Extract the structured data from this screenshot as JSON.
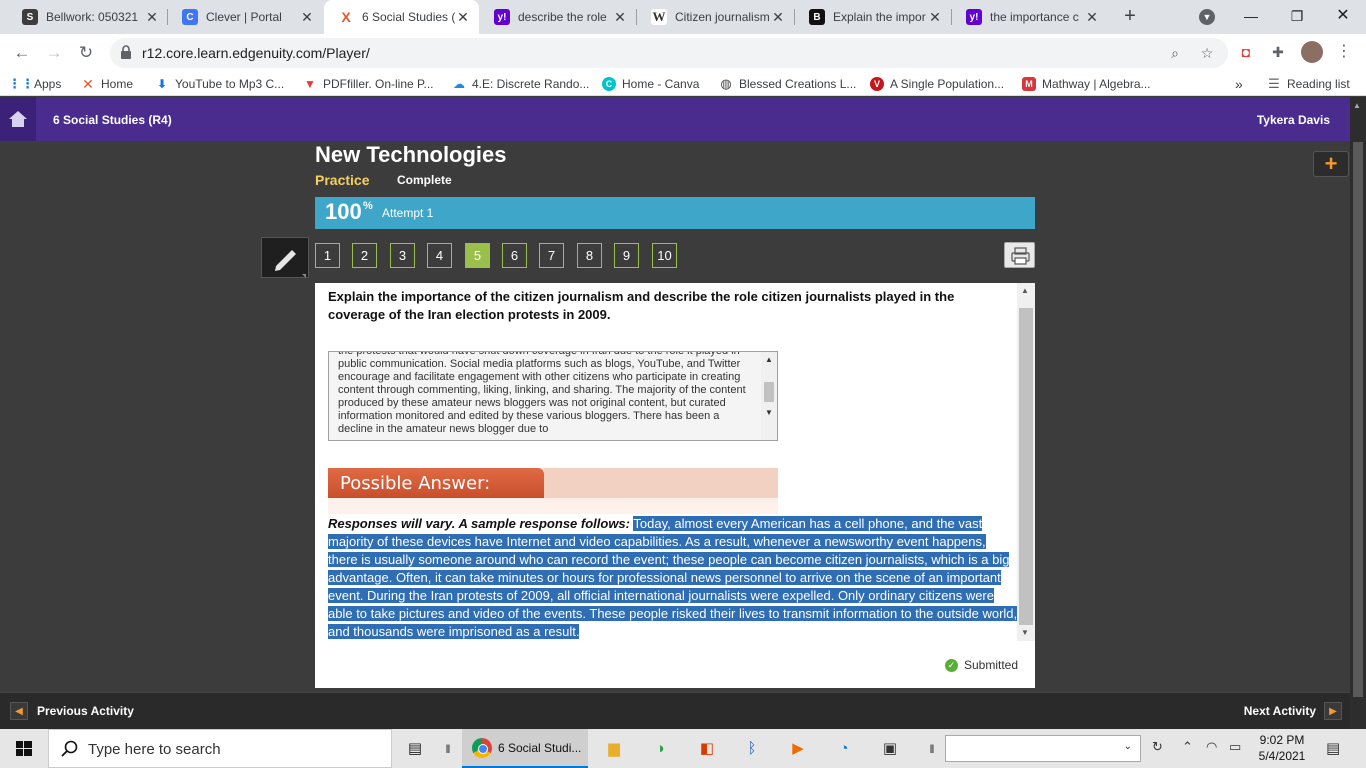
{
  "browser": {
    "tabs": [
      {
        "title": "Bellwork: 050321",
        "favicon": "S",
        "favicon_color": "#3c3c3c",
        "active": false
      },
      {
        "title": "Clever | Portal",
        "favicon": "C",
        "favicon_color": "#4274f6",
        "active": false
      },
      {
        "title": "6 Social Studies (",
        "favicon": "X",
        "favicon_color": "#e8572d",
        "active": true
      },
      {
        "title": "describe the role",
        "favicon": "y!",
        "favicon_color": "#6001d2",
        "active": false
      },
      {
        "title": "Citizen journalism",
        "favicon": "W",
        "favicon_color": "#555555",
        "active": false
      },
      {
        "title": "Explain the impor",
        "favicon": "B",
        "favicon_color": "#111111",
        "active": false
      },
      {
        "title": "the importance c",
        "favicon": "y!",
        "favicon_color": "#6001d2",
        "active": false
      }
    ],
    "url": "r12.core.learn.edgenuity.com/Player/",
    "bookmarks": [
      {
        "label": "Apps",
        "icon": "apps-grid-icon",
        "color": "#1a73e8"
      },
      {
        "label": "Home",
        "icon": "edgenuity-icon",
        "color": "#e8572d"
      },
      {
        "label": "YouTube to Mp3 C...",
        "icon": "download-icon",
        "color": "#1a73e8"
      },
      {
        "label": "PDFfiller. On-line P...",
        "icon": "pdffiller-icon",
        "color": "#e53935"
      },
      {
        "label": "4.E: Discrete Rando...",
        "icon": "cloud-icon",
        "color": "#1e88e5"
      },
      {
        "label": "Home - Canva",
        "icon": "canva-icon",
        "color": "#00c4cc"
      },
      {
        "label": "Blessed Creations L...",
        "icon": "globe-icon",
        "color": "#444444"
      },
      {
        "label": "A Single Population...",
        "icon": "v-icon",
        "color": "#c4161c"
      },
      {
        "label": "Mathway | Algebra...",
        "icon": "mathway-icon",
        "color": "#d7363c"
      }
    ],
    "reading_list": "Reading list"
  },
  "app": {
    "course": "6 Social Studies (R4)",
    "user": "Tykera Davis",
    "lesson_title": "New Technologies",
    "tab_practice": "Practice",
    "tab_complete": "Complete",
    "progress_value": "100",
    "progress_sign": "%",
    "attempt": "Attempt 1",
    "questions": [
      "1",
      "2",
      "3",
      "4",
      "5",
      "6",
      "7",
      "8",
      "9",
      "10"
    ],
    "current_question": "5",
    "accent_color": "#9abf4a",
    "header_color": "#4a2c8f",
    "progress_color": "#3ea6c8"
  },
  "question": {
    "prompt": "Explain the importance of the citizen journalism and describe the role citizen journalists played in the coverage of the Iran election protests in 2009.",
    "student_answer": "the protests that would have shut down coverage in Iran due to the role it played in public communication. Social media platforms such as blogs, YouTube, and Twitter encourage and facilitate engagement with other citizens who participate in creating content through commenting, liking, linking, and sharing. The majority of the content produced by these amateur news bloggers was not original content, but curated information monitored and edited by these various bloggers. There has been a decline in the amateur news blogger due to",
    "possible_answer_label": "Possible Answer:",
    "response_lead": "Responses will vary. A sample response follows:",
    "response_body": "Today, almost every American has a cell phone, and the vast majority of these devices have Internet and video capabilities. As a result, whenever a newsworthy event happens, there is usually someone around who can record the event; these people can become citizen journalists, which is a big advantage. Often, it can take minutes or hours for professional news personnel to arrive on the scene of an important event. During the Iran protests of 2009, all official international journalists were expelled. Only ordinary citizens were able to take pictures and video of the events. These people risked their lives to transmit information to the outside world, and thousands were imprisoned as a result.",
    "status": "Submitted"
  },
  "footer": {
    "previous": "Previous Activity",
    "next": "Next Activity"
  },
  "taskbar": {
    "search_placeholder": "Type here to search",
    "chrome_label": "6 Social Studi...",
    "time": "9:02 PM",
    "date": "5/4/2021"
  }
}
